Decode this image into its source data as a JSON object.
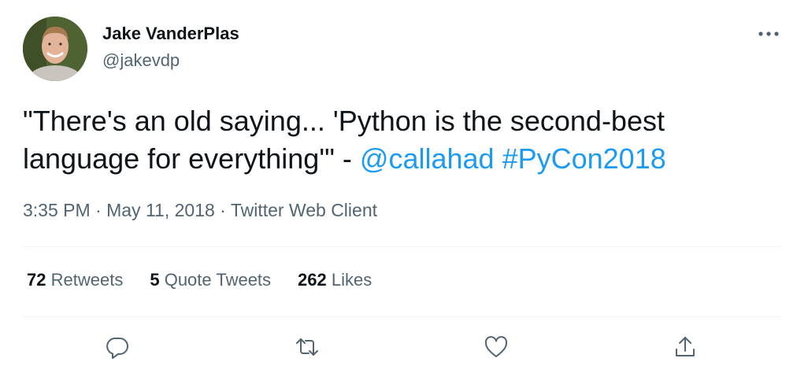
{
  "author": {
    "display_name": "Jake VanderPlas",
    "handle": "@jakevdp"
  },
  "tweet": {
    "text_quote": "\"There's an old saying... 'Python is the second-best language for everything'\" - ",
    "mention": "@callahad",
    "hashtag": "#PyCon2018"
  },
  "meta": {
    "time": "3:35 PM",
    "separator": " · ",
    "date": "May 11, 2018",
    "client": "Twitter Web Client"
  },
  "stats": {
    "retweets_count": "72",
    "retweets_label": "Retweets",
    "quotes_count": "5",
    "quotes_label": "Quote Tweets",
    "likes_count": "262",
    "likes_label": "Likes"
  },
  "icons": {
    "more": "more-horizontal-icon",
    "reply": "reply-icon",
    "retweet": "retweet-icon",
    "like": "heart-icon",
    "share": "share-icon"
  },
  "colors": {
    "link": "#1d9bf0",
    "text": "#0f1419",
    "secondary": "#536471",
    "divider": "#eff3f4"
  }
}
